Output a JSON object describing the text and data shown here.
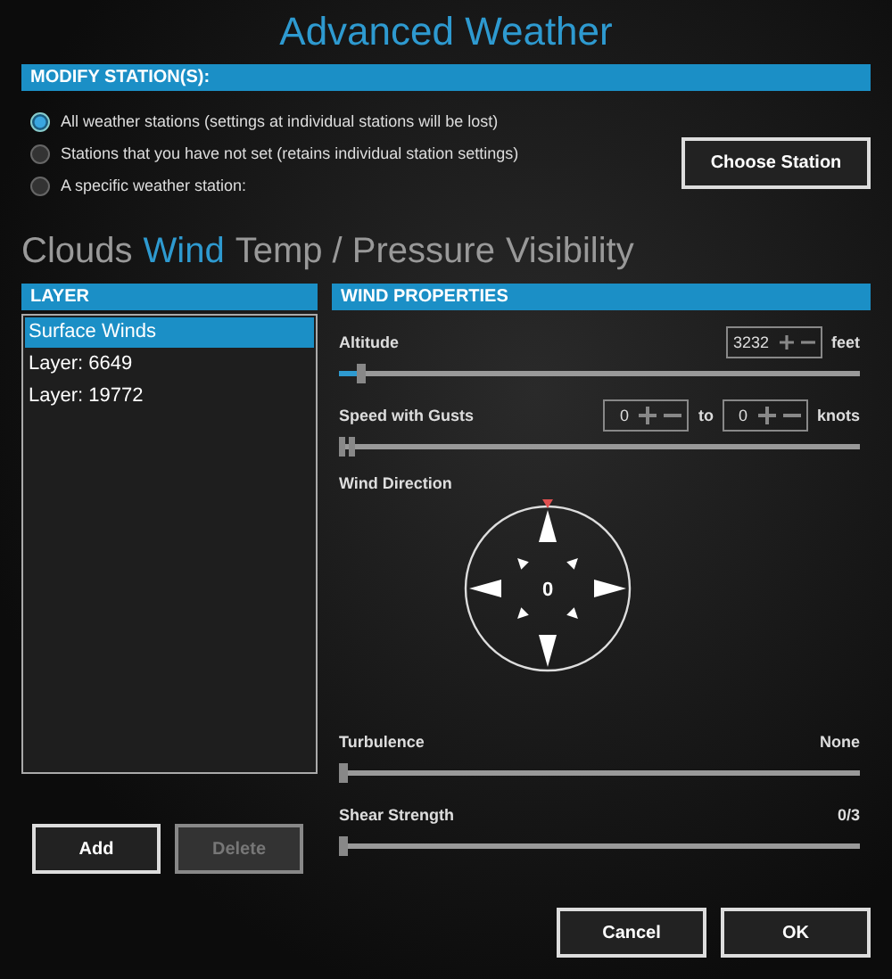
{
  "title": "Advanced Weather",
  "modify_stations": {
    "header": "MODIFY STATION(S):",
    "options": [
      {
        "label": "All weather stations (settings at individual stations will be lost)",
        "selected": true
      },
      {
        "label": "Stations that you have not set (retains individual station settings)",
        "selected": false
      },
      {
        "label": "A specific weather station:",
        "selected": false
      }
    ],
    "choose_button": "Choose Station"
  },
  "tabs": [
    {
      "label": "Clouds",
      "selected": false
    },
    {
      "label": "Wind",
      "selected": true
    },
    {
      "label": "Temp / Pressure",
      "selected": false
    },
    {
      "label": "Visibility",
      "selected": false
    }
  ],
  "layer_panel": {
    "header": "LAYER",
    "layers": [
      {
        "label": "Surface Winds",
        "selected": true
      },
      {
        "label": "Layer: 6649",
        "selected": false
      },
      {
        "label": "Layer: 19772",
        "selected": false
      }
    ],
    "buttons": [
      {
        "label": "Add",
        "disabled": false
      },
      {
        "label": "Delete",
        "disabled": true
      }
    ]
  },
  "wind_properties": {
    "header": "WIND PROPERTIES",
    "altitude": {
      "label": "Altitude",
      "value": "3232",
      "unit": "feet",
      "level": 0.04
    },
    "speed": {
      "label": "Speed with Gusts",
      "min_value": "0",
      "connector": "to",
      "max_value": "0",
      "unit": "knots",
      "level": 0
    },
    "wind_direction": {
      "label": "Wind Direction",
      "value": "0"
    },
    "turbulence": {
      "label": "Turbulence",
      "reading": "None",
      "level": 0
    },
    "shear": {
      "label": "Shear Strength",
      "reading": "0/3",
      "level": 0
    }
  },
  "buttons": [
    "Cancel",
    "OK"
  ]
}
